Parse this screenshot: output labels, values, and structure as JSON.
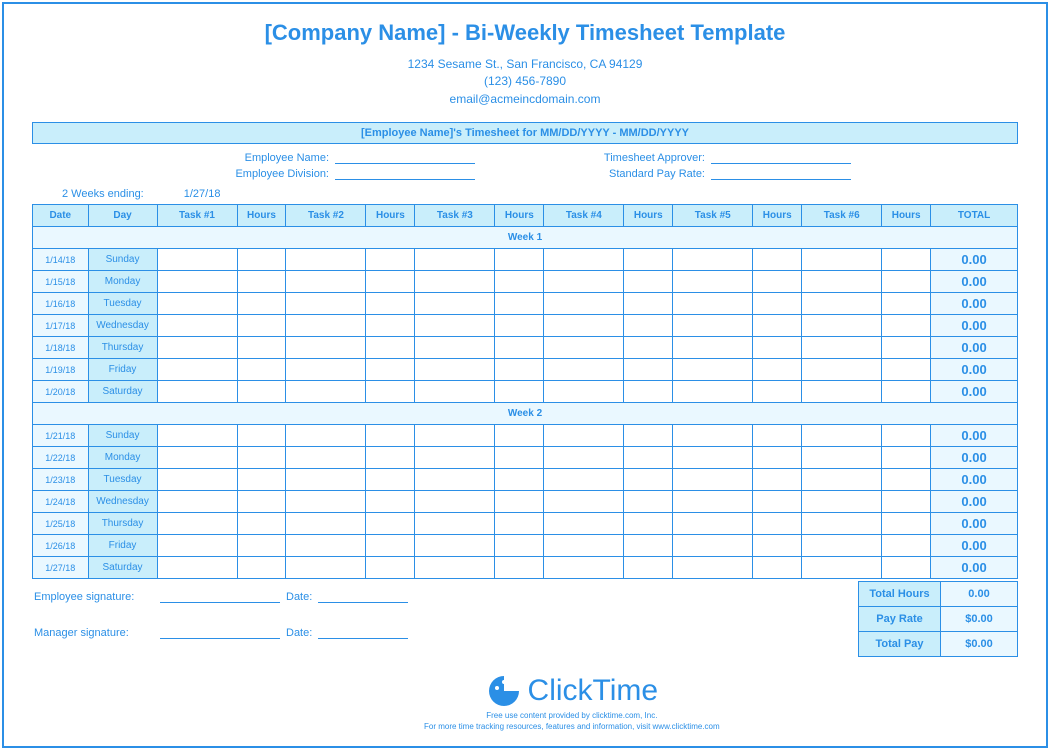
{
  "header": {
    "title": "[Company Name] - Bi-Weekly Timesheet Template",
    "address": "1234 Sesame St.,  San Francisco, CA 94129",
    "phone": "(123) 456-7890",
    "email": "email@acmeincdomain.com"
  },
  "subheader": "[Employee Name]'s Timesheet for MM/DD/YYYY - MM/DD/YYYY",
  "fields": {
    "emp_name_label": "Employee Name:",
    "emp_div_label": "Employee Division:",
    "approver_label": "Timesheet Approver:",
    "payrate_label": "Standard Pay Rate:"
  },
  "period": {
    "label": "2 Weeks ending:",
    "value": "1/27/18"
  },
  "columns": {
    "date": "Date",
    "day": "Day",
    "task1": "Task #1",
    "h1": "Hours",
    "task2": "Task #2",
    "h2": "Hours",
    "task3": "Task #3",
    "h3": "Hours",
    "task4": "Task #4",
    "h4": "Hours",
    "task5": "Task #5",
    "h5": "Hours",
    "task6": "Task #6",
    "h6": "Hours",
    "total": "TOTAL"
  },
  "week1_label": "Week 1",
  "week2_label": "Week 2",
  "week1": [
    {
      "date": "1/14/18",
      "day": "Sunday",
      "total": "0.00"
    },
    {
      "date": "1/15/18",
      "day": "Monday",
      "total": "0.00"
    },
    {
      "date": "1/16/18",
      "day": "Tuesday",
      "total": "0.00"
    },
    {
      "date": "1/17/18",
      "day": "Wednesday",
      "total": "0.00"
    },
    {
      "date": "1/18/18",
      "day": "Thursday",
      "total": "0.00"
    },
    {
      "date": "1/19/18",
      "day": "Friday",
      "total": "0.00"
    },
    {
      "date": "1/20/18",
      "day": "Saturday",
      "total": "0.00"
    }
  ],
  "week2": [
    {
      "date": "1/21/18",
      "day": "Sunday",
      "total": "0.00"
    },
    {
      "date": "1/22/18",
      "day": "Monday",
      "total": "0.00"
    },
    {
      "date": "1/23/18",
      "day": "Tuesday",
      "total": "0.00"
    },
    {
      "date": "1/24/18",
      "day": "Wednesday",
      "total": "0.00"
    },
    {
      "date": "1/25/18",
      "day": "Thursday",
      "total": "0.00"
    },
    {
      "date": "1/26/18",
      "day": "Friday",
      "total": "0.00"
    },
    {
      "date": "1/27/18",
      "day": "Saturday",
      "total": "0.00"
    }
  ],
  "signatures": {
    "emp_sig": "Employee signature:",
    "mgr_sig": "Manager signature:",
    "date_label": "Date:"
  },
  "summary": {
    "total_hours_label": "Total Hours",
    "total_hours": "0.00",
    "pay_rate_label": "Pay Rate",
    "pay_rate": "$0.00",
    "total_pay_label": "Total Pay",
    "total_pay": "$0.00"
  },
  "branding": {
    "logo_text": "ClickTime",
    "fine1": "Free use content provided by clicktime.com, Inc.",
    "fine2": "For more time tracking resources, features and information, visit www.clicktime.com"
  }
}
